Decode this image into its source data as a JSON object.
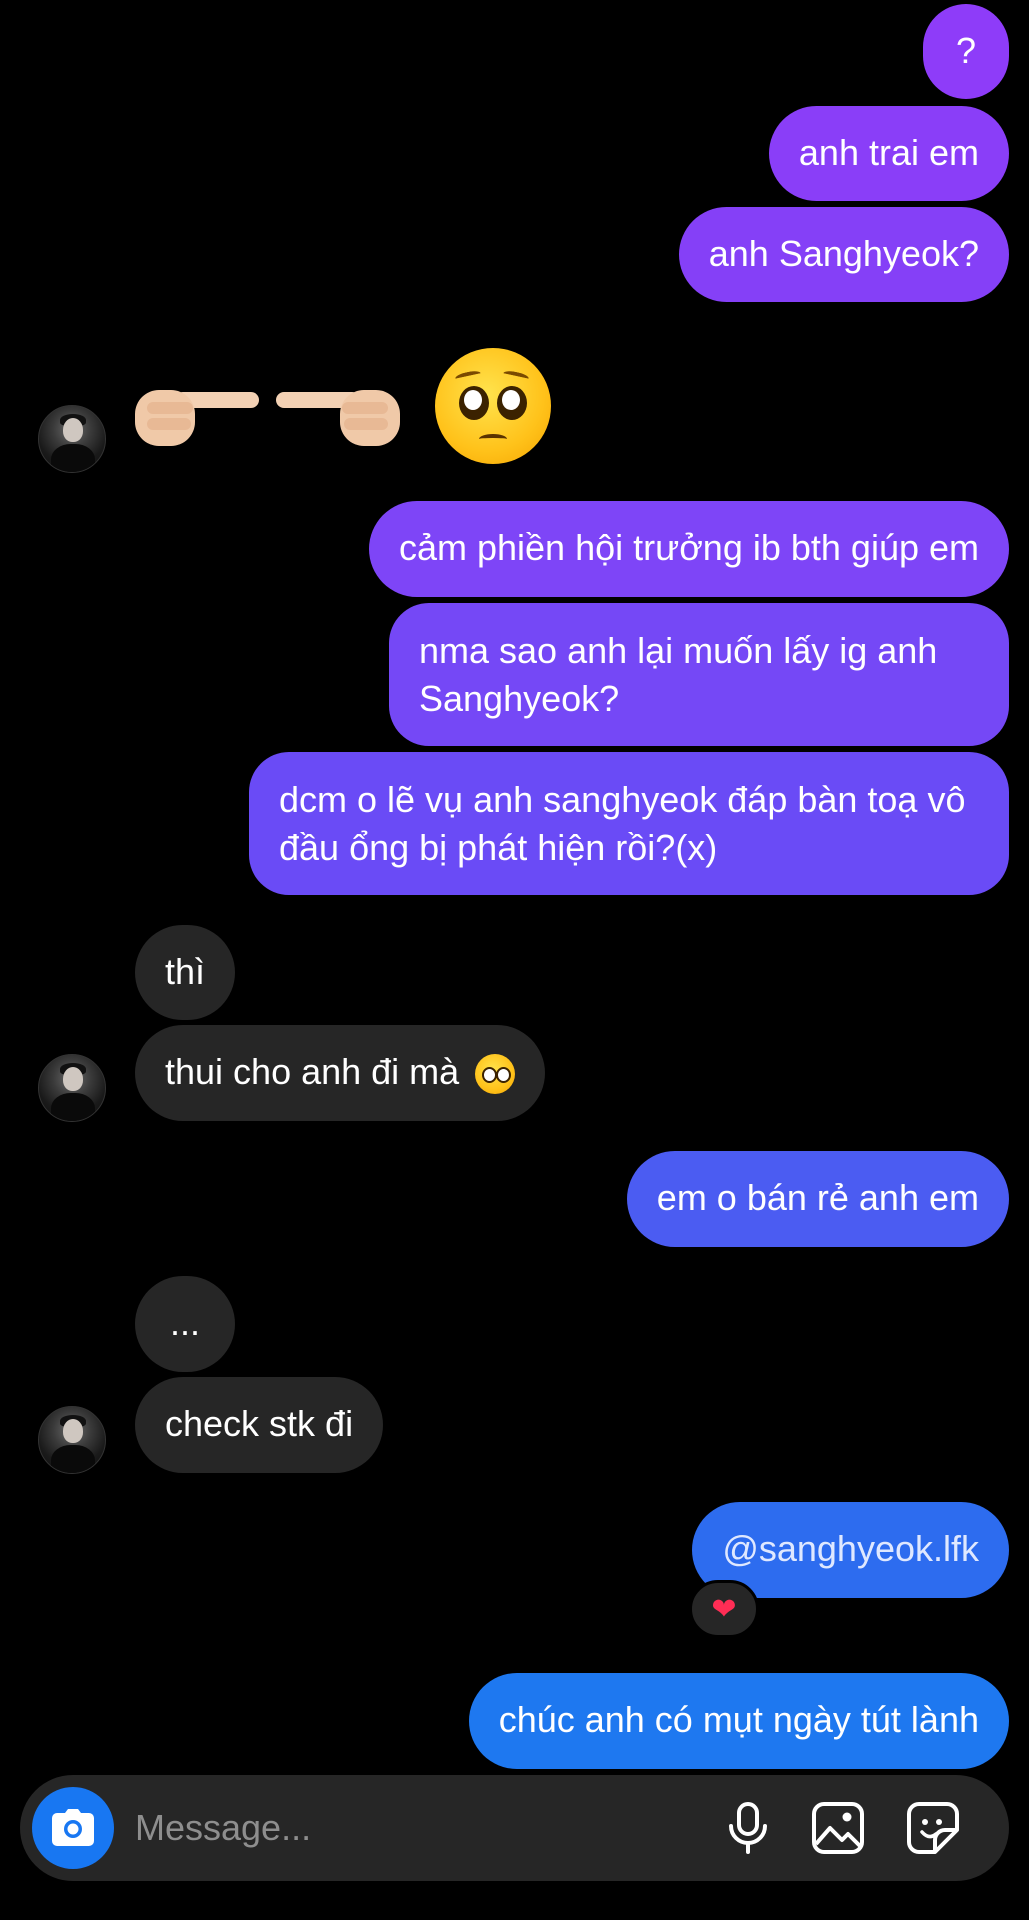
{
  "messages": [
    {
      "text": "?"
    },
    {
      "text": "anh trai em"
    },
    {
      "text": "anh Sanghyeok?"
    },
    {
      "text": "cảm phiền hội trưởng ib bth giúp em"
    },
    {
      "text": "nma sao anh lại muốn lấy ig anh Sanghyeok?"
    },
    {
      "text": "dcm o lẽ vụ anh sanghyeok đáp bàn toạ vô đầu ổng bị phát hiện rồi?(x)"
    },
    {
      "text": "thì"
    },
    {
      "text": "thui cho anh đi mà"
    },
    {
      "text": "em o bán rẻ anh em"
    },
    {
      "text": "..."
    },
    {
      "text": "check stk đi"
    },
    {
      "text": "@sanghyeok.lfk"
    },
    {
      "text": "chúc anh có mụt ngày tút lành"
    }
  ],
  "reaction": "❤",
  "composer": {
    "placeholder": "Message..."
  },
  "colors": {
    "bubble_purple": "#8a3ef8",
    "bubble_violet": "#6a4af6",
    "bubble_indigo": "#4b5cf2",
    "bubble_blue": "#1e78f0",
    "bubble_incoming": "#262626",
    "accent_blue": "#1877f2"
  },
  "icons": {
    "emoji_sticker": "pointing-fingers-and-pleading-face",
    "camera": "camera-icon",
    "mic": "microphone-icon",
    "gallery": "image-icon",
    "sticker": "sticker-icon"
  }
}
